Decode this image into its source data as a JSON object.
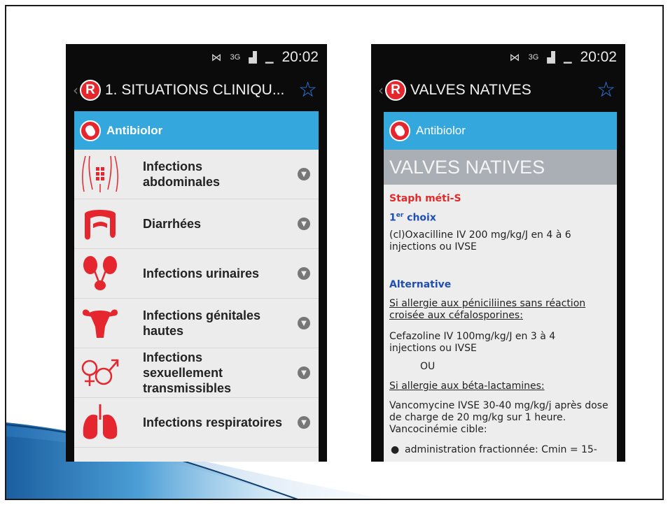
{
  "left_screen": {
    "status": {
      "time": "20:02",
      "network": "3G",
      "icons": [
        "mute-icon",
        "signal-icon",
        "battery-icon"
      ]
    },
    "action_bar": {
      "title": "1. SITUATIONS CLINIQU..."
    },
    "brand_band": {
      "label": "Antibiolor"
    },
    "items": [
      {
        "label": "Infections abdominales",
        "icon": "abdomen-icon"
      },
      {
        "label": "Diarrhées",
        "icon": "intestine-icon"
      },
      {
        "label": "Infections urinaires",
        "icon": "kidney-icon"
      },
      {
        "label": "Infections génitales hautes",
        "icon": "uterus-icon"
      },
      {
        "label": "Infections sexuellement transmissibles",
        "icon": "gender-symbols-icon"
      },
      {
        "label": "Infections respiratoires",
        "icon": "lungs-icon"
      }
    ]
  },
  "right_screen": {
    "status": {
      "time": "20:02",
      "network": "3G"
    },
    "action_bar": {
      "title": "VALVES NATIVES"
    },
    "brand_band": {
      "label": "Antibiolor"
    },
    "heading": "VALVES NATIVES",
    "section_title": "Staph méti-S",
    "first_choice_prefix": "1",
    "first_choice_sup": "er",
    "first_choice_suffix": " choix",
    "first_choice_text": "(cl)Oxacilline IV 200 mg/kg/J en 4 à 6 injections ou IVSE",
    "alternative_title": "Alternative",
    "allergy1": "Si allergie aux péniciliines sans réaction croisée aux céfalosporines:",
    "cefazoline": "Cefazoline IV 100mg/kg/J en 3 à 4 injections ou IVSE",
    "ou": "OU",
    "allergy2": "Si allergie aux béta-lactamines:",
    "vanco": "Vancomycine IVSE 30-40 mg/kg/j après dose de charge de 20 mg/kg sur 1 heure. Vancocinémie cible:",
    "bullet": "administration fractionnée: Cmin = 15-"
  },
  "colors": {
    "brand_red": "#e6262e",
    "band_blue": "#34a7dd",
    "star_blue": "#2f7ff0",
    "swoosh_blue": "#1f6fb0"
  }
}
